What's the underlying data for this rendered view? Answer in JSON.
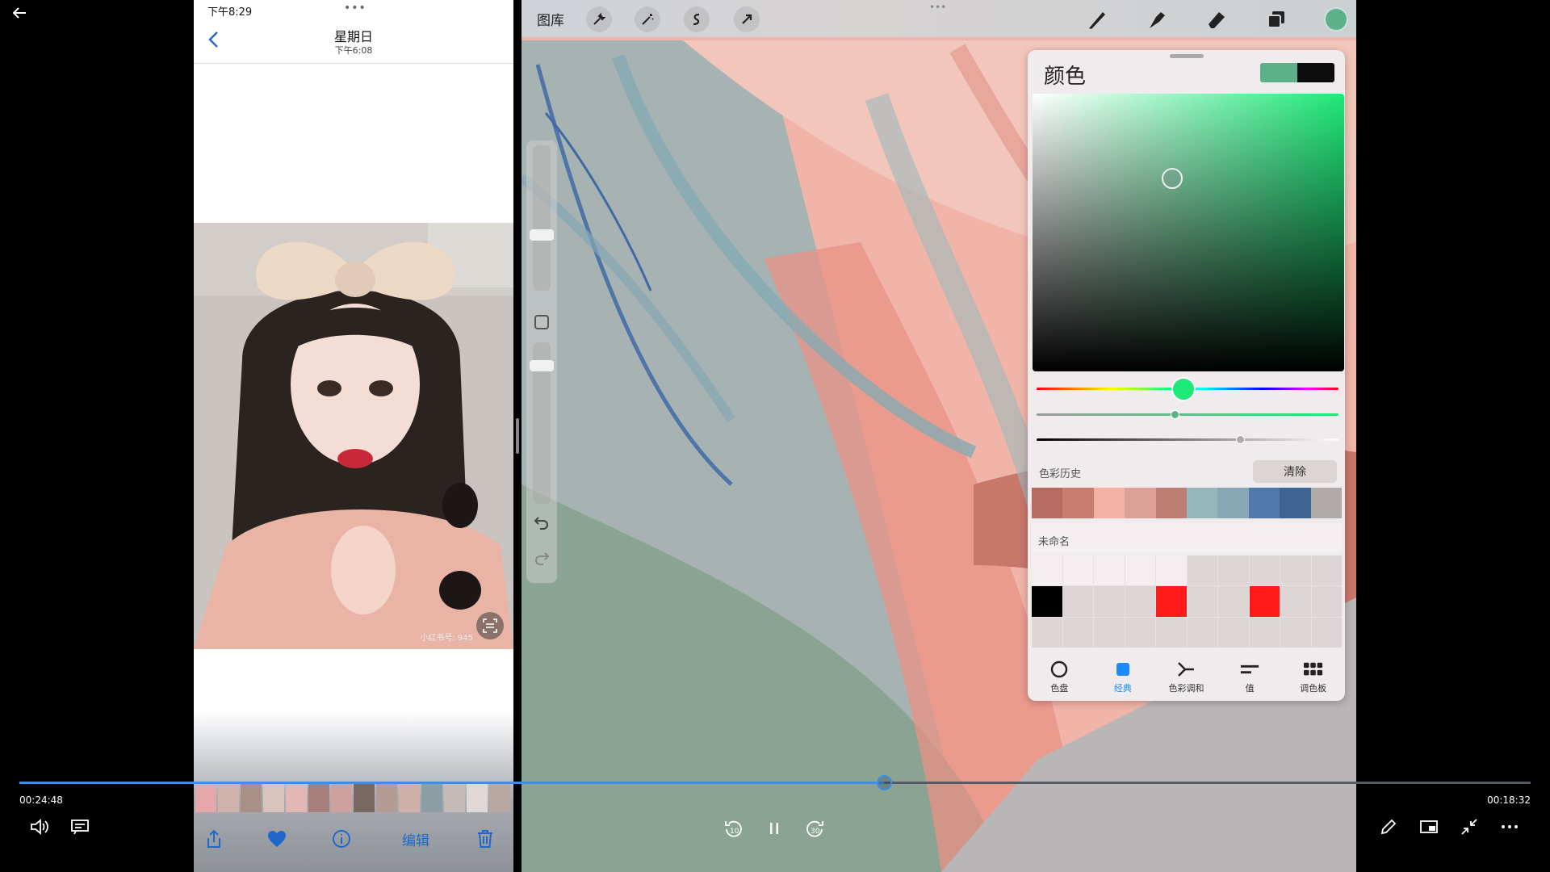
{
  "phone": {
    "status_time": "下午8:29",
    "more_dots": "•••",
    "title": "星期日",
    "subtitle": "下午6:08",
    "watermark": "小红书号: 945",
    "edit_label": "编辑"
  },
  "procreate": {
    "gallery_label": "图库",
    "top_dots": "•••",
    "current_color": "#5cb08a",
    "popup": {
      "title": "颜色",
      "primary_swatch": "#5cb08a",
      "secondary_swatch": "#0c0c0c",
      "history_label": "色彩历史",
      "clear_label": "清除",
      "history_colors": [
        "#b86b62",
        "#c97c70",
        "#f3b2a5",
        "#dba196",
        "#bd7e74",
        "#97b7bc",
        "#88a8b6",
        "#5078a8",
        "#3f6594",
        "#b2a9a9"
      ],
      "palette_name": "未命名",
      "palette_highlights": {
        "black": "#000000",
        "red": "#ff1a1a"
      },
      "tabs": [
        {
          "label": "色盘",
          "icon": "disc-icon"
        },
        {
          "label": "经典",
          "icon": "classic-square-icon"
        },
        {
          "label": "色彩调和",
          "icon": "harmony-icon"
        },
        {
          "label": "值",
          "icon": "value-sliders-icon"
        },
        {
          "label": "调色板",
          "icon": "palette-grid-icon"
        }
      ]
    }
  },
  "player": {
    "elapsed": "00:24:48",
    "remaining": "00:18:32",
    "progress_fraction": 0.572
  }
}
